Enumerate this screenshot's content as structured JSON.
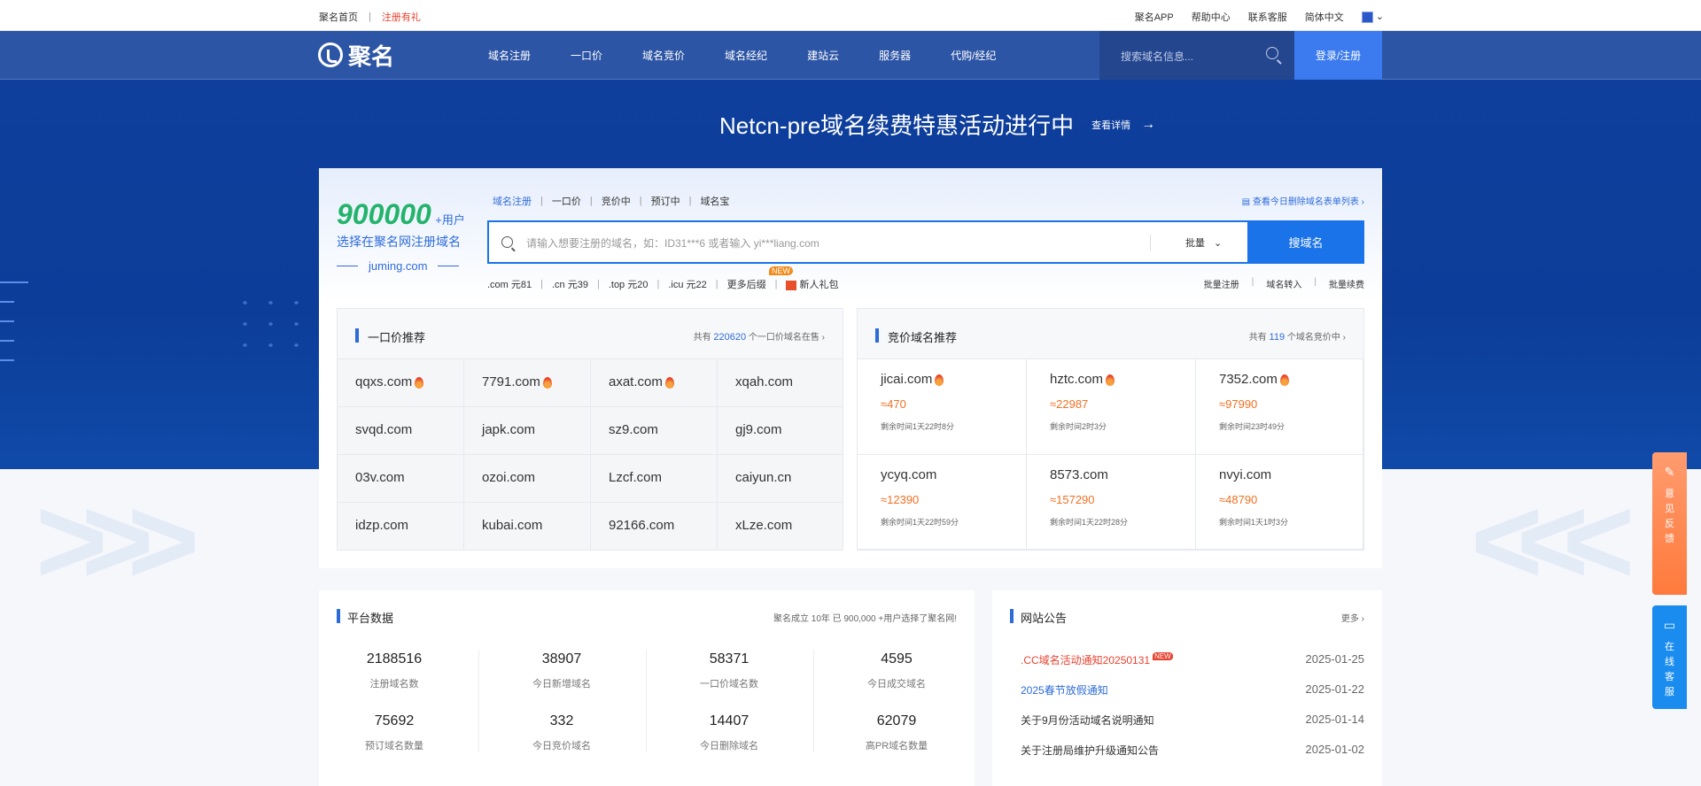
{
  "topbar": {
    "left_items": [
      "聚名首页",
      "注册有礼"
    ],
    "right_items": [
      "聚名APP",
      "帮助中心",
      "联系客服",
      "简体中文"
    ]
  },
  "nav": {
    "logo_text": "聚名",
    "menu": [
      "域名注册",
      "一口价",
      "域名竞价",
      "域名经纪",
      "建站云",
      "服务器",
      "代购/经纪"
    ],
    "search_placeholder": "搜索域名信息...",
    "login_label": "登录/注册"
  },
  "hero": {
    "title": "Netcn-pre域名续费特惠活动进行中",
    "more_label": "查看详情",
    "arrow": "→"
  },
  "promo": {
    "count": "900000",
    "plus": "+用户",
    "sub": "选择在聚名网注册域名",
    "site": "juming.com"
  },
  "search": {
    "tabs": [
      "域名注册",
      "一口价",
      "竞价中",
      "预订中",
      "域名宝"
    ],
    "report_link": "查看今日删除域名表单列表",
    "placeholder": "请输入想要注册的域名，如：ID31***6 或者输入 yi***liang.com",
    "mode": "批量",
    "button": "搜域名",
    "prices": [
      ".com 元81",
      ".cn 元39",
      ".top 元20",
      ".icu 元22",
      "更多后缀",
      "新人礼包"
    ],
    "new_badge": "NEW",
    "quick_links": [
      "批量注册",
      "域名转入",
      "批量续费"
    ]
  },
  "fixed": {
    "title": "一口价推荐",
    "meta_prefix": "共有",
    "meta_count": "220620",
    "meta_suffix": "个一口价域名在售",
    "domains": [
      {
        "name": "qqxs.com",
        "hot": true
      },
      {
        "name": "7791.com",
        "hot": true
      },
      {
        "name": "axat.com",
        "hot": true
      },
      {
        "name": "xqah.com",
        "hot": false
      },
      {
        "name": "svqd.com",
        "hot": false
      },
      {
        "name": "japk.com",
        "hot": false
      },
      {
        "name": "sz9.com",
        "hot": false
      },
      {
        "name": "gj9.com",
        "hot": false
      },
      {
        "name": "03v.com",
        "hot": false
      },
      {
        "name": "ozoi.com",
        "hot": false
      },
      {
        "name": "Lzcf.com",
        "hot": false
      },
      {
        "name": "caiyun.cn",
        "hot": false
      },
      {
        "name": "idzp.com",
        "hot": false
      },
      {
        "name": "kubai.com",
        "hot": false
      },
      {
        "name": "92166.com",
        "hot": false
      },
      {
        "name": "xLze.com",
        "hot": false
      }
    ]
  },
  "auction": {
    "title": "竞价域名推荐",
    "meta_prefix": "共有",
    "meta_count": "119",
    "meta_suffix": "个域名竞价中",
    "items": [
      {
        "name": "jicai.com",
        "price": "≈470",
        "time": "剩余时间1天22时8分",
        "hot": true
      },
      {
        "name": "hztc.com",
        "price": "≈22987",
        "time": "剩余时间2时3分",
        "hot": true
      },
      {
        "name": "7352.com",
        "price": "≈97990",
        "time": "剩余时间23时49分",
        "hot": true
      },
      {
        "name": "ycyq.com",
        "price": "≈12390",
        "time": "剩余时间1天22时59分",
        "hot": false
      },
      {
        "name": "8573.com",
        "price": "≈157290",
        "time": "剩余时间1天22时28分",
        "hot": false
      },
      {
        "name": "nvyi.com",
        "price": "≈48790",
        "time": "剩余时间1天1时3分",
        "hot": false
      }
    ]
  },
  "stats": {
    "title": "平台数据",
    "meta": "聚名成立 10年 已 900,000 +用户选择了聚名网!",
    "items": [
      {
        "value": "2188516",
        "label": "注册域名数"
      },
      {
        "value": "38907",
        "label": "今日新增域名"
      },
      {
        "value": "58371",
        "label": "一口价域名数"
      },
      {
        "value": "4595",
        "label": "今日成交域名"
      },
      {
        "value": "75692",
        "label": "预订域名数量"
      },
      {
        "value": "332",
        "label": "今日竞价域名"
      },
      {
        "value": "14407",
        "label": "今日删除域名"
      },
      {
        "value": "62079",
        "label": "高PR域名数量"
      }
    ]
  },
  "news": {
    "title": "网站公告",
    "more_label": "更多",
    "items": [
      {
        "title": ".CC域名活动通知20250131",
        "date": "2025-01-25",
        "style": "red",
        "new": true
      },
      {
        "title": "2025春节放假通知",
        "date": "2025-01-22",
        "style": "blue",
        "new": false
      },
      {
        "title": "关于9月份活动域名说明通知",
        "date": "2025-01-14",
        "style": "",
        "new": false
      },
      {
        "title": "关于注册局维护升级通知公告",
        "date": "2025-01-02",
        "style": "",
        "new": false
      }
    ],
    "new_badge": "NEW"
  },
  "float": {
    "feedback": "意见反馈",
    "service": "在线客服"
  },
  "colors": {
    "nav_bg": "#2d55a5",
    "hero_bg": "#0e3f9c",
    "accent": "#1a73e8",
    "price_orange": "#f27022",
    "promo_green": "#23b36b"
  }
}
